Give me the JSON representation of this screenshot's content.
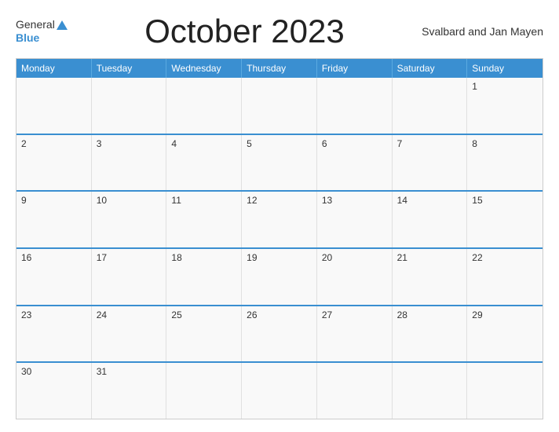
{
  "header": {
    "title": "October 2023",
    "region": "Svalbard and Jan Mayen",
    "logo_general": "General",
    "logo_blue": "Blue"
  },
  "calendar": {
    "days_of_week": [
      "Monday",
      "Tuesday",
      "Wednesday",
      "Thursday",
      "Friday",
      "Saturday",
      "Sunday"
    ],
    "weeks": [
      [
        {
          "day": "",
          "empty": true
        },
        {
          "day": "",
          "empty": true
        },
        {
          "day": "",
          "empty": true
        },
        {
          "day": "",
          "empty": true
        },
        {
          "day": "",
          "empty": true
        },
        {
          "day": "",
          "empty": true
        },
        {
          "day": "1",
          "empty": false
        }
      ],
      [
        {
          "day": "2",
          "empty": false
        },
        {
          "day": "3",
          "empty": false
        },
        {
          "day": "4",
          "empty": false
        },
        {
          "day": "5",
          "empty": false
        },
        {
          "day": "6",
          "empty": false
        },
        {
          "day": "7",
          "empty": false
        },
        {
          "day": "8",
          "empty": false
        }
      ],
      [
        {
          "day": "9",
          "empty": false
        },
        {
          "day": "10",
          "empty": false
        },
        {
          "day": "11",
          "empty": false
        },
        {
          "day": "12",
          "empty": false
        },
        {
          "day": "13",
          "empty": false
        },
        {
          "day": "14",
          "empty": false
        },
        {
          "day": "15",
          "empty": false
        }
      ],
      [
        {
          "day": "16",
          "empty": false
        },
        {
          "day": "17",
          "empty": false
        },
        {
          "day": "18",
          "empty": false
        },
        {
          "day": "19",
          "empty": false
        },
        {
          "day": "20",
          "empty": false
        },
        {
          "day": "21",
          "empty": false
        },
        {
          "day": "22",
          "empty": false
        }
      ],
      [
        {
          "day": "23",
          "empty": false
        },
        {
          "day": "24",
          "empty": false
        },
        {
          "day": "25",
          "empty": false
        },
        {
          "day": "26",
          "empty": false
        },
        {
          "day": "27",
          "empty": false
        },
        {
          "day": "28",
          "empty": false
        },
        {
          "day": "29",
          "empty": false
        }
      ],
      [
        {
          "day": "30",
          "empty": false
        },
        {
          "day": "31",
          "empty": false
        },
        {
          "day": "",
          "empty": true
        },
        {
          "day": "",
          "empty": true
        },
        {
          "day": "",
          "empty": true
        },
        {
          "day": "",
          "empty": true
        },
        {
          "day": "",
          "empty": true
        }
      ]
    ]
  }
}
